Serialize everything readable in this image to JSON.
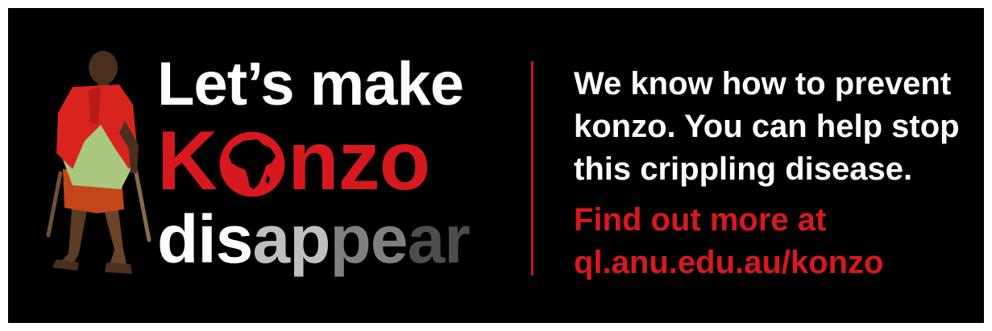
{
  "headline": {
    "line1": "Let’s make",
    "line2_part1": "K",
    "line2_part2": "nzo",
    "line3_segments": [
      {
        "text": "dis",
        "color": "#ffffff"
      },
      {
        "text": "ap",
        "color": "#bfbfbf"
      },
      {
        "text": "pe",
        "color": "#7f7f7f"
      },
      {
        "text": "ar",
        "color": "#4d4d4d"
      }
    ]
  },
  "message": {
    "line1": "We know how to prevent",
    "line2": "konzo. You can help stop",
    "line3": "this crippling disease.",
    "cta_line1": "Find out more at",
    "cta_line2": "ql.anu.edu.au/konzo"
  },
  "colors": {
    "background": "#000000",
    "accent_red": "#d7191f",
    "text_white": "#ffffff"
  },
  "icons": {
    "o_letter": "africa-map-icon",
    "figure": "child-on-crutches-figure"
  }
}
